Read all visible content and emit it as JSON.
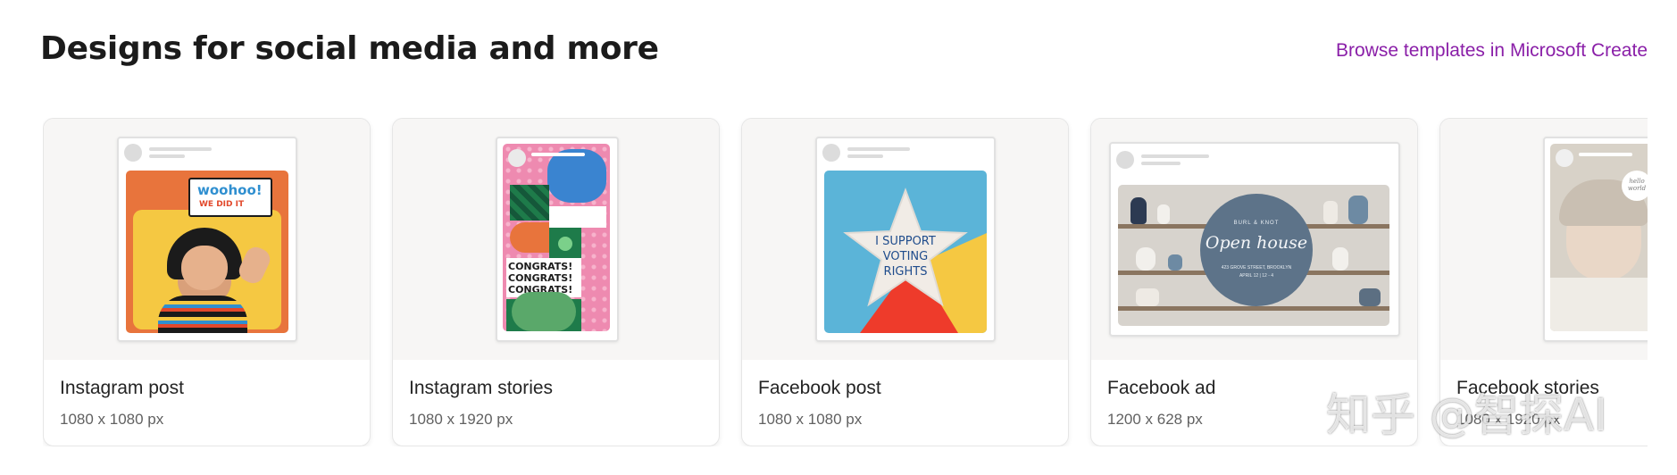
{
  "header": {
    "title": "Designs for social media and more",
    "browse_link": "Browse templates in Microsoft Create"
  },
  "cards": [
    {
      "label": "Instagram post",
      "dims": "1080 x 1080 px",
      "art": {
        "speech_line1": "woohoo!",
        "speech_line2": "WE DID IT"
      }
    },
    {
      "label": "Instagram stories",
      "dims": "1080 x 1920 px",
      "art": {
        "congrats": [
          "CONGRATS!",
          "CONGRATS!",
          "CONGRATS!"
        ]
      }
    },
    {
      "label": "Facebook post",
      "dims": "1080 x 1080 px",
      "art": {
        "star_text": [
          "I SUPPORT",
          "VOTING",
          "RIGHTS"
        ]
      }
    },
    {
      "label": "Facebook ad",
      "dims": "1200 x 628 px",
      "art": {
        "open_house": "Open house",
        "small_top": "BURL & KNOT",
        "small_bottom": "423 GROVE STREET, BROOKLYN",
        "date": "APRIL 12 | 12 - 4"
      }
    },
    {
      "label": "Facebook stories",
      "dims": "1080 x 1920 px",
      "art": {
        "badge": "hello world"
      }
    }
  ],
  "watermark": "知乎 @智探AI",
  "colors": {
    "link": "#8a1fa8",
    "orange": "#e8743c",
    "yellow": "#f5c842",
    "sky": "#5bb4d8",
    "green": "#1e7b4a",
    "pink": "#ee8ab0",
    "slate": "#5d7389"
  }
}
